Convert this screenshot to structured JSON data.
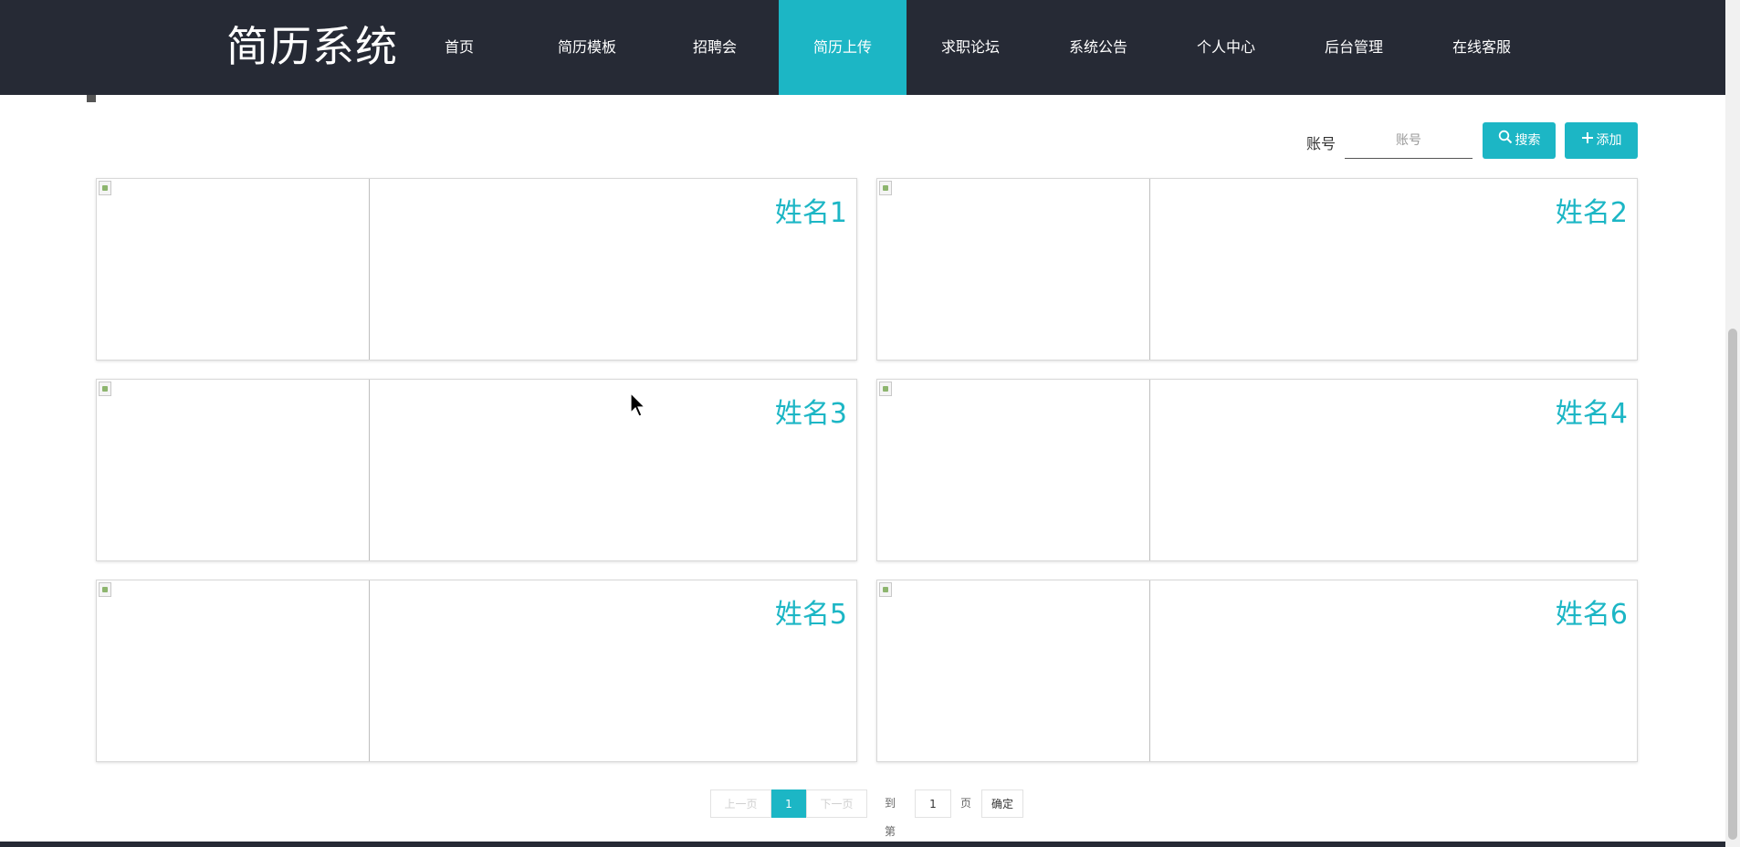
{
  "header": {
    "brand": "简历系统",
    "nav": [
      {
        "label": "首页",
        "active": false
      },
      {
        "label": "简历模板",
        "active": false
      },
      {
        "label": "招聘会",
        "active": false
      },
      {
        "label": "简历上传",
        "active": true
      },
      {
        "label": "求职论坛",
        "active": false
      },
      {
        "label": "系统公告",
        "active": false
      },
      {
        "label": "个人中心",
        "active": false
      },
      {
        "label": "后台管理",
        "active": false
      },
      {
        "label": "在线客服",
        "active": false
      }
    ]
  },
  "search": {
    "label": "账号",
    "placeholder": "账号",
    "search_button": "搜索",
    "search_icon": "search-icon",
    "add_button": "添加",
    "add_icon": "plus-icon"
  },
  "cards": [
    {
      "name": "姓名1"
    },
    {
      "name": "姓名2"
    },
    {
      "name": "姓名3"
    },
    {
      "name": "姓名4"
    },
    {
      "name": "姓名5"
    },
    {
      "name": "姓名6"
    }
  ],
  "pagination": {
    "prev": "上一页",
    "current": "1",
    "next": "下一页",
    "goto_label": "到第",
    "goto_value": "1",
    "page_label": "页",
    "confirm": "确定"
  },
  "colors": {
    "accent": "#1cb6c5",
    "header_bg": "#262a35"
  }
}
